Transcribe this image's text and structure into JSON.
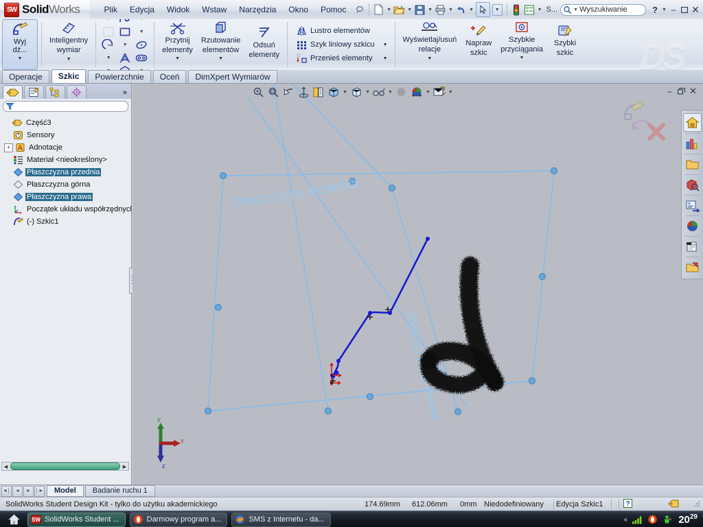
{
  "app": {
    "brand_bold": "Solid",
    "brand_light": "Works",
    "logo_text": "SW",
    "watermark": "DS"
  },
  "menubar": {
    "items": [
      "Plik",
      "Edycja",
      "Widok",
      "Wstaw",
      "Narzędzia",
      "Okno",
      "Pomoc"
    ],
    "search_placeholder": "Wyszukiwanie",
    "search_value": "Wyszukiwanie",
    "doc_label": "S...",
    "help_label": "?",
    "minimize": "–",
    "restore": "❐",
    "close": "✕",
    "icons": [
      "new-doc-icon",
      "open-folder-icon",
      "save-icon",
      "print-icon",
      "undo-icon",
      "select-arrow-icon",
      "rebuild-icon",
      "options-icon",
      "search-icon"
    ]
  },
  "ribbon": {
    "groups": [
      {
        "name": "exit-sketch",
        "buttons": [
          {
            "label": "Wyj\ndź...",
            "label_line1": "Wyj",
            "label_line2": "dź...",
            "icon": "exit-sketch-icon",
            "active": true,
            "dropdown": true
          }
        ]
      },
      {
        "name": "smart-dimension",
        "buttons": [
          {
            "label_line1": "Inteligentny",
            "label_line2": "wymiar",
            "icon": "smart-dimension-icon",
            "dropdown": true
          }
        ]
      },
      {
        "name": "sketch-entities",
        "tools": [
          "line-icon",
          "circle-icon",
          "spline-icon",
          "grid-icon",
          "rectangle-icon",
          "arc-icon",
          "ellipse-icon",
          "text-icon",
          "slot-icon",
          "polygon-icon",
          "fillet-icon",
          "point-icon"
        ]
      },
      {
        "name": "modify-tools",
        "buttons": [
          {
            "label_line1": "Przytnij",
            "label_line2": "elementy",
            "icon": "trim-entities-icon",
            "dropdown": true
          },
          {
            "label_line1": "Rzutowanie",
            "label_line2": "elementów",
            "icon": "convert-entities-icon",
            "dropdown": true
          },
          {
            "label_line1": "Odsuń",
            "label_line2": "elementy",
            "icon": "offset-entities-icon"
          }
        ]
      },
      {
        "name": "pattern-tools",
        "rows": [
          {
            "label": "Lustro elementów",
            "icon": "mirror-entities-icon",
            "caret": false
          },
          {
            "label": "Szyk liniowy szkicu",
            "icon": "linear-pattern-icon",
            "caret": true
          },
          {
            "label": "Przenieś elementy",
            "icon": "move-entities-icon",
            "caret": true
          }
        ]
      },
      {
        "name": "display-relations",
        "buttons": [
          {
            "label_line1": "Wyświetlaj/usuń",
            "label_line2": "relacje",
            "icon": "display-relations-icon",
            "dropdown": true
          },
          {
            "label_line1": "Napraw",
            "label_line2": "szkic",
            "icon": "repair-sketch-icon"
          },
          {
            "label_line1": "Szybkie",
            "label_line2": "przyciągania",
            "icon": "quick-snaps-icon",
            "dropdown": true
          },
          {
            "label_line1": "Szybki",
            "label_line2": "szkic",
            "icon": "rapid-sketch-icon"
          }
        ]
      }
    ]
  },
  "tabs": {
    "items": [
      "Operacje",
      "Szkic",
      "Powierzchnie",
      "Oceń",
      "DimXpert Wymiarów"
    ],
    "selected_index": 1
  },
  "feature_manager": {
    "tabs": [
      "feature-tree-icon",
      "property-manager-icon",
      "configuration-manager-icon",
      "dimxpert-manager-icon"
    ],
    "selected_tab": 0,
    "more": "»",
    "filter_placeholder": "",
    "filter_value": "",
    "tree": [
      {
        "label": "Część3",
        "icon": "part-icon",
        "depth": 0,
        "selected": false,
        "expander": ""
      },
      {
        "label": "Sensory",
        "icon": "sensors-icon",
        "depth": 1,
        "selected": false,
        "expander": ""
      },
      {
        "label": "Adnotacje",
        "icon": "annotations-icon",
        "depth": 1,
        "selected": false,
        "expander": "+"
      },
      {
        "label": "Materiał <nieokreślony>",
        "icon": "material-icon",
        "depth": 1,
        "selected": false,
        "expander": ""
      },
      {
        "label": "Płaszczyzna przednia",
        "icon": "plane-icon",
        "depth": 1,
        "selected": true,
        "expander": ""
      },
      {
        "label": "Płaszczyzna górna",
        "icon": "plane-plain-icon",
        "depth": 1,
        "selected": false,
        "expander": ""
      },
      {
        "label": "Płaszczyzna prawa",
        "icon": "plane-icon",
        "depth": 1,
        "selected": true,
        "expander": ""
      },
      {
        "label": "Początek układu współrzędnych",
        "icon": "origin-icon",
        "depth": 1,
        "selected": false,
        "expander": ""
      },
      {
        "label": "(-) Szkic1",
        "icon": "sketch-icon",
        "depth": 1,
        "selected": false,
        "expander": ""
      }
    ]
  },
  "graphics": {
    "toolbar_icons": [
      "zoom-to-fit-icon",
      "zoom-to-area-icon",
      "previous-view-icon",
      "section-view-icon",
      "view-orientation-icon",
      "display-style-icon",
      "hide-show-icon",
      "edit-appearance-icon",
      "apply-scene-icon",
      "view-settings-icon"
    ],
    "window_buttons": {
      "minimize": "–",
      "restore": "❐",
      "close": "✕"
    },
    "plane_labels": [
      {
        "text": "Płaszczyzna przednia",
        "name": "front-plane-label"
      },
      {
        "text": "Płaszczyzna prawa",
        "name": "right-plane-label"
      }
    ],
    "triad": {
      "x": "x",
      "y": "y",
      "z": "z"
    },
    "sketch_corner": {
      "confirm": "exit-sketch-icon",
      "cancel": "cancel-sketch-icon"
    }
  },
  "right_dock": {
    "buttons": [
      {
        "name": "solidworks-resources-icon",
        "selected": true
      },
      {
        "name": "design-library-icon",
        "selected": false
      },
      {
        "name": "file-explorer-icon",
        "selected": false
      },
      {
        "name": "search-model-icon",
        "selected": false
      },
      {
        "name": "view-palette-icon",
        "selected": false
      },
      {
        "name": "appearances-scenes-icon",
        "selected": false
      },
      {
        "name": "custom-properties-icon",
        "selected": false
      },
      {
        "name": "document-recovery-icon",
        "selected": false
      }
    ]
  },
  "model_bar": {
    "nav_buttons": [
      "first-icon",
      "previous-icon",
      "next-icon",
      "last-icon"
    ],
    "tabs": [
      "Model",
      "Badanie ruchu 1"
    ],
    "selected_index": 0
  },
  "statusbar": {
    "message": "SolidWorks Student Design Kit - tylko do użytku akademickiego",
    "coord_x": "174.69mm",
    "coord_y": "612.06mm",
    "coord_z": "0mm",
    "state": "Niedodefiniowany",
    "mode": "Edycja Szkic1",
    "help_icon": "context-help-icon",
    "tag_icon": "tags-icon"
  },
  "taskbar": {
    "start": "start-icon",
    "buttons": [
      {
        "label": "SolidWorks Student ...",
        "icon": "solidworks-app-icon",
        "active": true
      },
      {
        "label": "Darmowy program a...",
        "icon": "browser-app-icon",
        "active": false
      },
      {
        "label": "SMS z Internetu - da...",
        "icon": "firefox-app-icon",
        "active": false
      }
    ],
    "tray_expand": "«",
    "tray_icons": [
      "signal-icon",
      "opera-icon",
      "updater-icon"
    ],
    "clock_time": "20",
    "clock_minutes": "29"
  }
}
